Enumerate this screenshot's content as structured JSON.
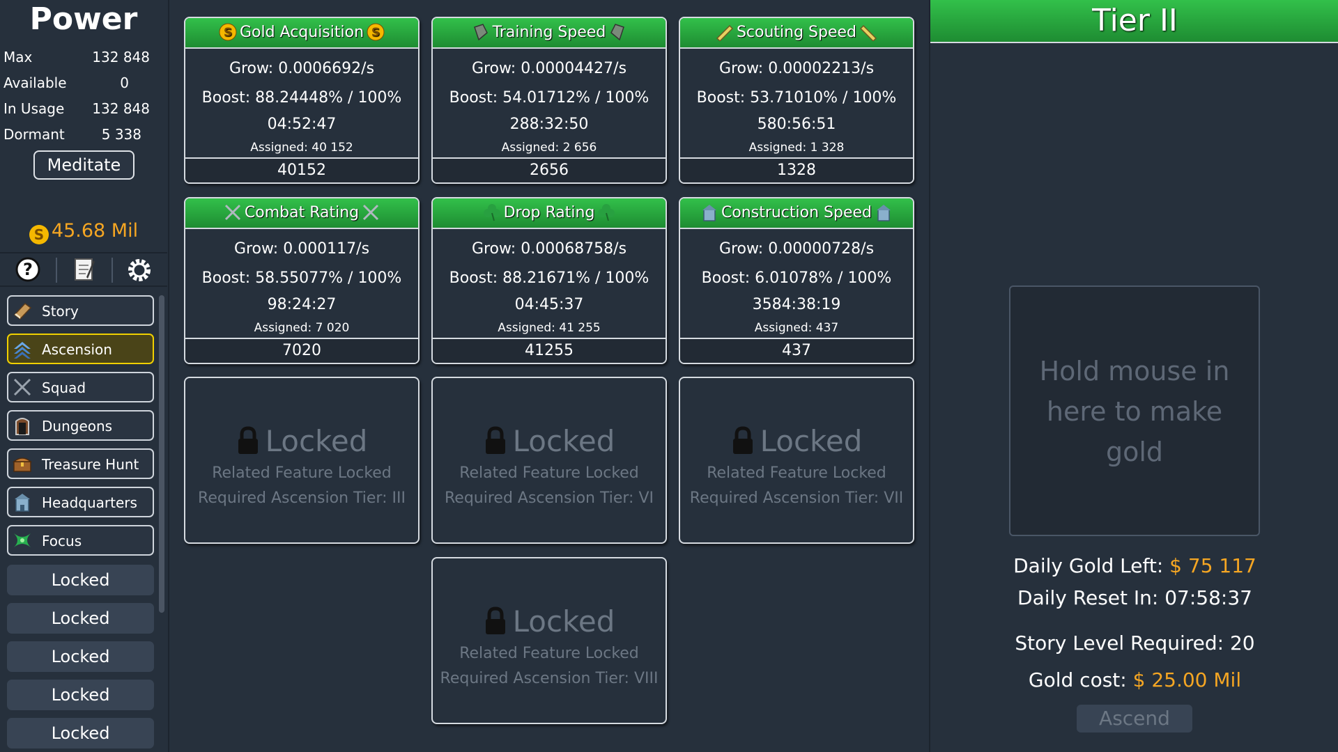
{
  "power": {
    "title": "Power",
    "stats": [
      {
        "label": "Max",
        "value": "132 848"
      },
      {
        "label": "Available",
        "value": "0"
      },
      {
        "label": "In Usage",
        "value": "132 848"
      },
      {
        "label": "Dormant",
        "value": "5 338"
      }
    ],
    "meditate_label": "Meditate",
    "gold": "45.68 Mil",
    "coin_glyph": "S"
  },
  "icon_bar": {
    "help": "help-icon",
    "notes": "clipboard-icon",
    "settings": "gear-icon"
  },
  "nav": {
    "items": [
      {
        "label": "Story",
        "icon": "book-icon"
      },
      {
        "label": "Ascension",
        "icon": "chevrons-up-icon"
      },
      {
        "label": "Squad",
        "icon": "crossed-swords-icon"
      },
      {
        "label": "Dungeons",
        "icon": "door-icon"
      },
      {
        "label": "Treasure Hunt",
        "icon": "chest-icon"
      },
      {
        "label": "Headquarters",
        "icon": "building-icon"
      },
      {
        "label": "Focus",
        "icon": "focus-icon"
      }
    ],
    "locked": [
      "Locked",
      "Locked",
      "Locked",
      "Locked",
      "Locked"
    ]
  },
  "cards": [
    {
      "title": "Gold Acquisition",
      "grow": "Grow: 0.0006692/s",
      "boost": "Boost: 88.24448% / 100%",
      "time": "04:52:47",
      "assigned": "Assigned: 40 152",
      "input": "40152",
      "icon": "coin-icon"
    },
    {
      "title": "Training Speed",
      "grow": "Grow: 0.00004427/s",
      "boost": "Boost: 54.01712% / 100%",
      "time": "288:32:50",
      "assigned": "Assigned: 2 656",
      "input": "2656",
      "icon": "shield-icon"
    },
    {
      "title": "Scouting Speed",
      "grow": "Grow: 0.00002213/s",
      "boost": "Boost: 53.71010% / 100%",
      "time": "580:56:51",
      "assigned": "Assigned: 1 328",
      "input": "1328",
      "icon": "spyglass-icon"
    },
    {
      "title": "Combat Rating",
      "grow": "Grow: 0.000117/s",
      "boost": "Boost: 58.55077% / 100%",
      "time": "98:24:27",
      "assigned": "Assigned: 7 020",
      "input": "7020",
      "icon": "crossed-swords-icon"
    },
    {
      "title": "Drop Rating",
      "grow": "Grow: 0.00068758/s",
      "boost": "Boost: 88.21671% / 100%",
      "time": "04:45:37",
      "assigned": "Assigned: 41 255",
      "input": "41255",
      "icon": "clover-icon"
    },
    {
      "title": "Construction Speed",
      "grow": "Grow: 0.00000728/s",
      "boost": "Boost: 6.01078% / 100%",
      "time": "3584:38:19",
      "assigned": "Assigned: 437",
      "input": "437",
      "icon": "building-icon"
    }
  ],
  "locked_cards": [
    {
      "title": "Locked",
      "sub1": "Related Feature Locked",
      "sub2": "Required Ascension Tier: III"
    },
    {
      "title": "Locked",
      "sub1": "Related Feature Locked",
      "sub2": "Required Ascension Tier: VI"
    },
    {
      "title": "Locked",
      "sub1": "Related Feature Locked",
      "sub2": "Required Ascension Tier: VII"
    },
    {
      "title": "Locked",
      "sub1": "Related Feature Locked",
      "sub2": "Required Ascension Tier: VIII"
    }
  ],
  "tier": {
    "title": "Tier II",
    "hold_text": "Hold mouse in here to make gold",
    "daily_gold_label": "Daily Gold Left: ",
    "daily_gold_value": "$ 75 117",
    "daily_reset": "Daily Reset In: 07:58:37",
    "story_level": "Story Level Required: 20",
    "gold_cost_label": "Gold cost: ",
    "gold_cost_value": "$ 25.00 Mil",
    "ascend_label": "Ascend"
  },
  "colors": {
    "background": "#26303c",
    "header_green": "#2aa840",
    "gold": "#f5a623",
    "active_border": "#f0d000",
    "locked_text": "#6c7784"
  }
}
